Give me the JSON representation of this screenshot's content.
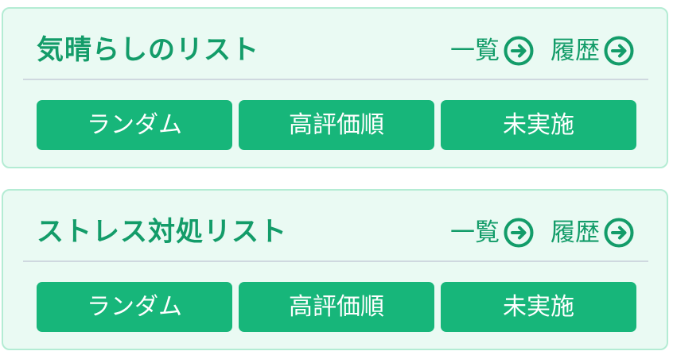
{
  "colors": {
    "accent": "#139c69",
    "button_bg": "#17b67a",
    "card_bg": "#eafaf3",
    "card_border": "#b4ecd4",
    "divider": "#cfd8df"
  },
  "cards": [
    {
      "title": "気晴らしのリスト",
      "links": [
        {
          "label": "一覧",
          "icon": "arrow-right-circle-icon"
        },
        {
          "label": "履歴",
          "icon": "arrow-right-circle-icon"
        }
      ],
      "buttons": [
        "ランダム",
        "高評価順",
        "未実施"
      ]
    },
    {
      "title": "ストレス対処リスト",
      "links": [
        {
          "label": "一覧",
          "icon": "arrow-right-circle-icon"
        },
        {
          "label": "履歴",
          "icon": "arrow-right-circle-icon"
        }
      ],
      "buttons": [
        "ランダム",
        "高評価順",
        "未実施"
      ]
    }
  ]
}
